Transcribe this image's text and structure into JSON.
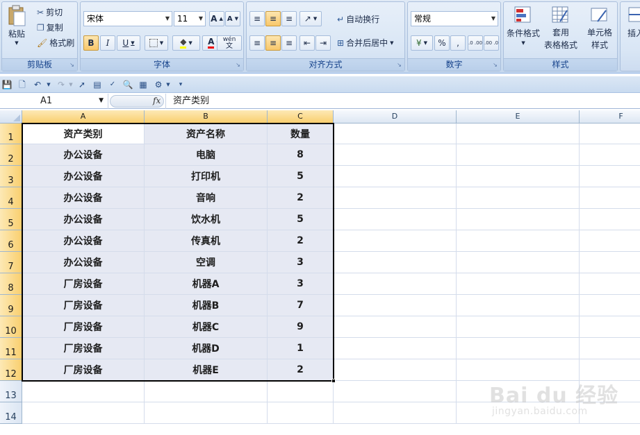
{
  "ribbon": {
    "clipboard": {
      "paste": "粘贴",
      "cut": "剪切",
      "copy": "复制",
      "format_painter": "格式刷",
      "group_label": "剪贴板"
    },
    "font": {
      "font_name": "宋体",
      "font_size": "11",
      "bold": "B",
      "italic": "I",
      "underline": "U",
      "group_label": "字体",
      "phonetic": "wén"
    },
    "alignment": {
      "wrap_text": "自动换行",
      "merge_center": "合并后居中",
      "group_label": "对齐方式"
    },
    "number": {
      "format": "常规",
      "percent": "%",
      "comma": ",",
      "inc_decimal": ".0 .00",
      "dec_decimal": ".00 .0",
      "group_label": "数字"
    },
    "styles": {
      "conditional": "条件格式",
      "table_format_1": "套用",
      "table_format_2": "表格格式",
      "cell_styles_1": "单元格",
      "cell_styles_2": "样式",
      "group_label": "样式"
    },
    "cells": {
      "insert": "插入"
    }
  },
  "formula_bar": {
    "name_box": "A1",
    "fx": "fx",
    "content": "资产类别"
  },
  "columns": [
    "A",
    "B",
    "C",
    "D",
    "E",
    "F"
  ],
  "rows": [
    "1",
    "2",
    "3",
    "4",
    "5",
    "6",
    "7",
    "8",
    "9",
    "10",
    "11",
    "12",
    "13",
    "14"
  ],
  "table": {
    "header": [
      "资产类别",
      "资产名称",
      "数量"
    ],
    "rows": [
      [
        "办公设备",
        "电脑",
        "8"
      ],
      [
        "办公设备",
        "打印机",
        "5"
      ],
      [
        "办公设备",
        "音响",
        "2"
      ],
      [
        "办公设备",
        "饮水机",
        "5"
      ],
      [
        "办公设备",
        "传真机",
        "2"
      ],
      [
        "办公设备",
        "空调",
        "3"
      ],
      [
        "厂房设备",
        "机器A",
        "3"
      ],
      [
        "厂房设备",
        "机器B",
        "7"
      ],
      [
        "厂房设备",
        "机器C",
        "9"
      ],
      [
        "厂房设备",
        "机器D",
        "1"
      ],
      [
        "厂房设备",
        "机器E",
        "2"
      ]
    ]
  },
  "watermark": {
    "logo": "Bai du 经验",
    "url": "jingyan.baidu.com"
  },
  "colors": {
    "selection_header": "#f9cf6f",
    "selection_fill": "#e6e9f3",
    "ribbon_text": "#15428b"
  }
}
